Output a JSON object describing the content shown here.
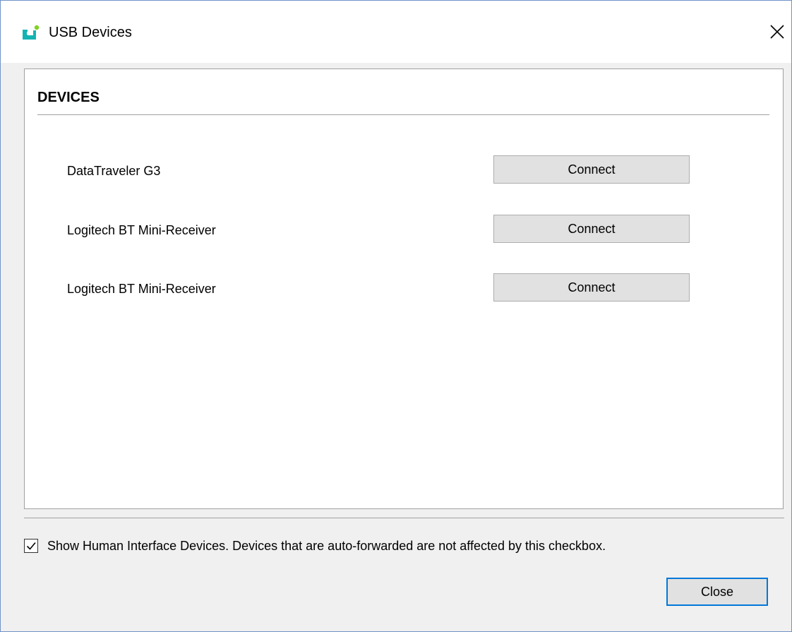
{
  "window": {
    "title": "USB Devices",
    "icon": "usb-device-icon",
    "close_icon": "close-icon"
  },
  "devices_panel": {
    "heading": "DEVICES",
    "devices": [
      {
        "name": "DataTraveler G3",
        "action_label": "Connect"
      },
      {
        "name": "Logitech BT Mini-Receiver",
        "action_label": "Connect"
      },
      {
        "name": "Logitech BT Mini-Receiver",
        "action_label": "Connect"
      }
    ]
  },
  "options": {
    "show_hid_checked": true,
    "show_hid_label": "Show Human Interface Devices. Devices that are auto-forwarded are not affected by this checkbox."
  },
  "footer": {
    "close_label": "Close"
  },
  "colors": {
    "accent": "#0078d7",
    "icon_teal": "#14b3b3",
    "icon_green": "#7ed321",
    "window_border": "#6f93c7",
    "button_face": "#e1e1e1",
    "dialog_background": "#f0f0f0"
  }
}
